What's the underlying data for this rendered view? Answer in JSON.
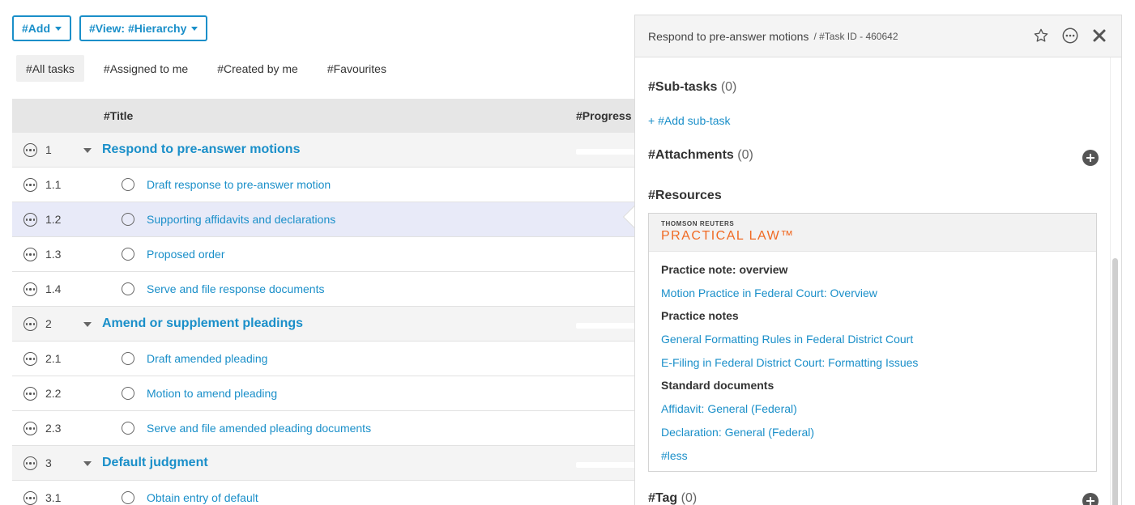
{
  "toolbar": {
    "add_label": "#Add",
    "view_label": "#View: #Hierarchy"
  },
  "filters": [
    "#All tasks",
    "#Assigned to me",
    "#Created by me",
    "#Favourites"
  ],
  "table": {
    "headers": {
      "title": "#Title",
      "progress": "#Progress"
    },
    "rows": [
      {
        "num": "1",
        "title": "Respond to pre-answer motions",
        "parent": true
      },
      {
        "num": "1.1",
        "title": "Draft response to pre-answer motion",
        "parent": false
      },
      {
        "num": "1.2",
        "title": "Supporting affidavits and declarations",
        "parent": false,
        "selected": true
      },
      {
        "num": "1.3",
        "title": "Proposed order",
        "parent": false
      },
      {
        "num": "1.4",
        "title": "Serve and file response documents",
        "parent": false
      },
      {
        "num": "2",
        "title": "Amend or supplement pleadings",
        "parent": true
      },
      {
        "num": "2.1",
        "title": "Draft amended pleading",
        "parent": false
      },
      {
        "num": "2.2",
        "title": "Motion to amend pleading",
        "parent": false
      },
      {
        "num": "2.3",
        "title": "Serve and file amended pleading documents",
        "parent": false
      },
      {
        "num": "3",
        "title": "Default judgment",
        "parent": true
      },
      {
        "num": "3.1",
        "title": "Obtain entry of default",
        "parent": false
      }
    ]
  },
  "panel": {
    "task_title": "Respond to pre-answer motions",
    "task_id": "/ #Task ID - 460642",
    "subtasks": {
      "label": "#Sub-tasks",
      "count": "(0)",
      "add_label": "+ #Add sub-task"
    },
    "attachments": {
      "label": "#Attachments",
      "count": "(0)"
    },
    "resources": {
      "label": "#Resources",
      "brand_top": "THOMSON REUTERS",
      "brand_main": "PRACTICAL LAW™",
      "groups": [
        {
          "category": "Practice note: overview",
          "links": [
            "Motion Practice in Federal Court: Overview"
          ]
        },
        {
          "category": "Practice notes",
          "links": [
            "General Formatting Rules in Federal District Court",
            "E-Filing in Federal District Court: Formatting Issues"
          ]
        },
        {
          "category": "Standard documents",
          "links": [
            "Affidavit: General (Federal)",
            "Declaration: General (Federal)"
          ]
        }
      ],
      "less_label": "#less"
    },
    "tag": {
      "label": "#Tag",
      "count": "(0)"
    }
  },
  "icons": {
    "star": "star-icon",
    "more": "more-options-icon",
    "close": "close-icon",
    "plus": "plus-circle-icon"
  }
}
